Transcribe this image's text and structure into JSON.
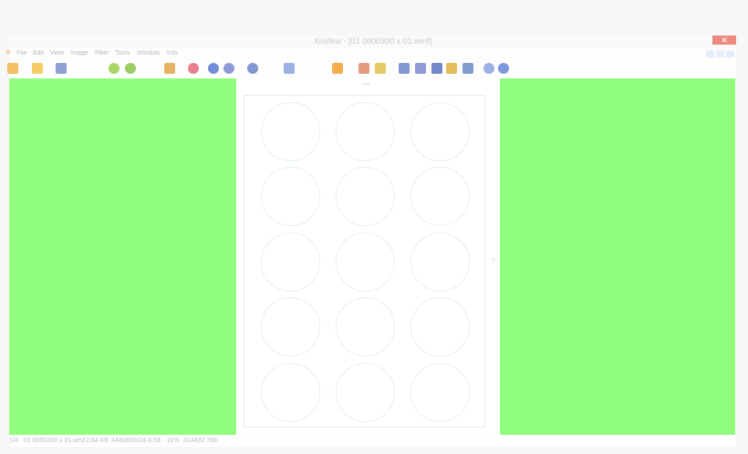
{
  "window": {
    "title": "XnView - [01 0000300 x 01.wmf]",
    "close_symbol": "✕"
  },
  "menubar": {
    "items": [
      "File",
      "Edit",
      "View",
      "Image",
      "Filter",
      "Tools",
      "Window",
      "Info"
    ]
  },
  "toolbar": {
    "buttons": [
      {
        "icon": "browse-icon",
        "color": "#f4b44a"
      },
      {
        "icon": "open-folder-icon",
        "color": "#f2c64a"
      },
      {
        "icon": "save-icon",
        "color": "#7d8fd0"
      },
      {
        "icon": "rotate-left-icon",
        "color": "#9bd04a"
      },
      {
        "icon": "rotate-right-icon",
        "color": "#8bc44a"
      },
      {
        "icon": "fullscreen-icon",
        "color": "#e4a44a"
      },
      {
        "icon": "ribbon-icon",
        "color": "#e46a7a"
      },
      {
        "icon": "zoom-in-icon",
        "color": "#5a7ad0"
      },
      {
        "icon": "zoom-fit-icon",
        "color": "#7a8ad0"
      },
      {
        "icon": "zoom-out-icon",
        "color": "#6a86c6"
      },
      {
        "icon": "next-arrow-icon",
        "color": "#8aa2e0"
      },
      {
        "icon": "folder-icon",
        "color": "#f0a030"
      },
      {
        "icon": "thumbnails-icon",
        "color": "#e08a6a"
      },
      {
        "icon": "slideshow-icon",
        "color": "#e0c04a"
      },
      {
        "icon": "binoculars-icon",
        "color": "#6a86c6"
      },
      {
        "icon": "print-icon",
        "color": "#7a8ad0"
      },
      {
        "icon": "scanner-icon",
        "color": "#5a72c0"
      },
      {
        "icon": "gallery-icon",
        "color": "#e0b040"
      },
      {
        "icon": "screen-capture-icon",
        "color": "#6a8ac6"
      },
      {
        "icon": "settings-icon",
        "color": "#8aa2e0"
      },
      {
        "icon": "info-icon",
        "color": "#6a86d6"
      }
    ]
  },
  "statusbar": {
    "index": "1/4",
    "filename": "01 0000300 x 01.wmf",
    "filesize": "2.84 KB",
    "dimensions": "443x600x24 8.59",
    "zoom": "11%",
    "extra": "314432 768"
  },
  "colors": {
    "panel_bg": "#92fe7f",
    "accent": "#ee8b80"
  }
}
